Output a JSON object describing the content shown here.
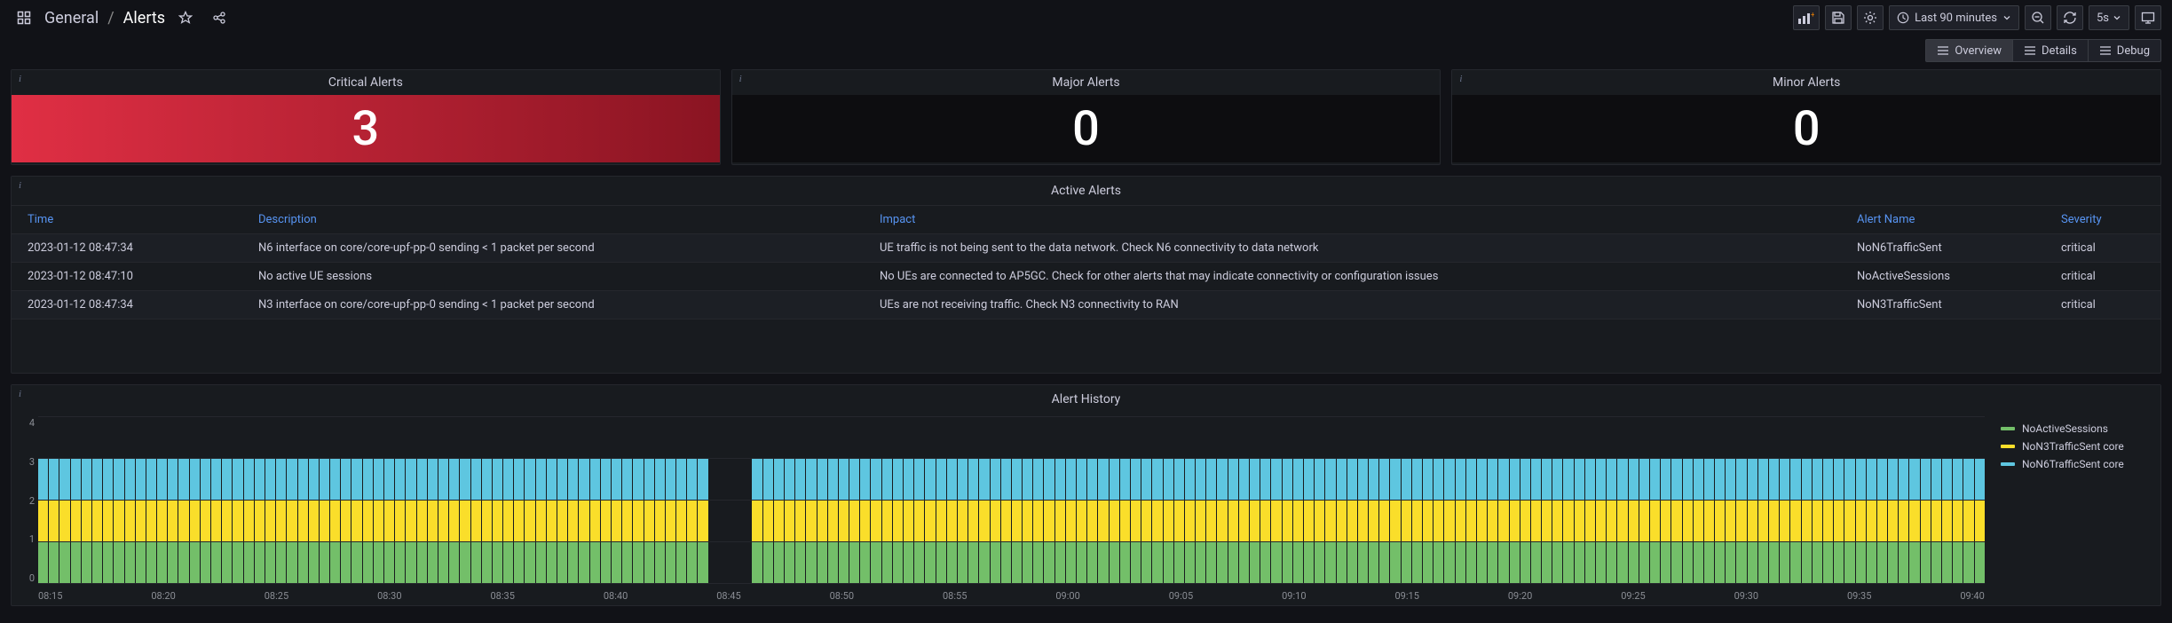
{
  "breadcrumb": {
    "folder": "General",
    "title": "Alerts"
  },
  "timepicker": {
    "label": "Last 90 minutes",
    "refresh": "5s"
  },
  "tabs": {
    "overview": "Overview",
    "details": "Details",
    "debug": "Debug",
    "active": "Overview"
  },
  "stats": {
    "critical": {
      "title": "Critical Alerts",
      "value": "3"
    },
    "major": {
      "title": "Major Alerts",
      "value": "0"
    },
    "minor": {
      "title": "Minor Alerts",
      "value": "0"
    }
  },
  "active_alerts": {
    "title": "Active Alerts",
    "columns": {
      "time": "Time",
      "desc": "Description",
      "impact": "Impact",
      "name": "Alert Name",
      "sev": "Severity"
    },
    "rows": [
      {
        "time": "2023-01-12 08:47:34",
        "desc": "N6 interface on core/core-upf-pp-0 sending < 1 packet per second",
        "impact": "UE traffic is not being sent to the data network. Check N6 connectivity to data network",
        "name": "NoN6TrafficSent",
        "sev": "critical"
      },
      {
        "time": "2023-01-12 08:47:10",
        "desc": "No active UE sessions",
        "impact": "No UEs are connected to AP5GC. Check for other alerts that may indicate connectivity or configuration issues",
        "name": "NoActiveSessions",
        "sev": "critical"
      },
      {
        "time": "2023-01-12 08:47:34",
        "desc": "N3 interface on core/core-upf-pp-0 sending < 1 packet per second",
        "impact": "UEs are not receiving traffic. Check N3 connectivity to RAN",
        "name": "NoN3TrafficSent",
        "sev": "critical"
      }
    ]
  },
  "history": {
    "title": "Alert History",
    "legend": [
      {
        "label": "NoActiveSessions",
        "color": "#73bf69"
      },
      {
        "label": "NoN3TrafficSent core",
        "color": "#fade2a"
      },
      {
        "label": "NoN6TrafficSent core",
        "color": "#5ec6e0"
      }
    ]
  },
  "chart_data": {
    "type": "bar",
    "stacked": true,
    "title": "Alert History",
    "ylabel": "",
    "xlabel": "",
    "ylim": [
      0,
      4
    ],
    "yticks": [
      0,
      1,
      2,
      3,
      4
    ],
    "xticks": [
      "08:15",
      "08:20",
      "08:25",
      "08:30",
      "08:35",
      "08:40",
      "08:45",
      "08:50",
      "08:55",
      "09:00",
      "09:05",
      "09:10",
      "09:15",
      "09:20",
      "09:25",
      "09:30",
      "09:35",
      "09:40"
    ],
    "n_bars": 180,
    "gap_range": [
      62,
      66
    ],
    "series": [
      {
        "name": "NoActiveSessions",
        "color": "#73bf69",
        "value_each": 1
      },
      {
        "name": "NoN3TrafficSent core",
        "color": "#fade2a",
        "value_each": 1
      },
      {
        "name": "NoN6TrafficSent core",
        "color": "#5ec6e0",
        "value_each": 1
      }
    ]
  }
}
